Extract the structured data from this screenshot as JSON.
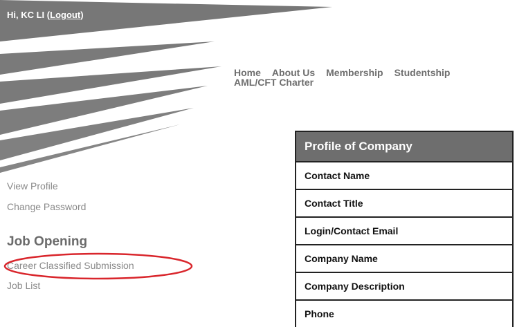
{
  "header": {
    "greeting": "Hi, KC LI",
    "logout_open": "(",
    "logout_label": "Logout",
    "logout_close": ")"
  },
  "nav": {
    "items": [
      "Home",
      "About Us",
      "Membership",
      "Studentship",
      "AML/CFT Charter"
    ]
  },
  "sidebar": {
    "view_profile": "View Profile",
    "change_password": "Change Password",
    "job_heading": "Job Opening",
    "career_submission": "Career Classified Submission",
    "job_list": "Job List"
  },
  "profile": {
    "title": "Profile of Company",
    "rows": [
      "Contact Name",
      "Contact Title",
      "Login/Contact Email",
      "Company Name",
      "Company Description",
      "Phone"
    ]
  },
  "colors": {
    "banner": "#777777",
    "highlight": "#d9262c"
  }
}
